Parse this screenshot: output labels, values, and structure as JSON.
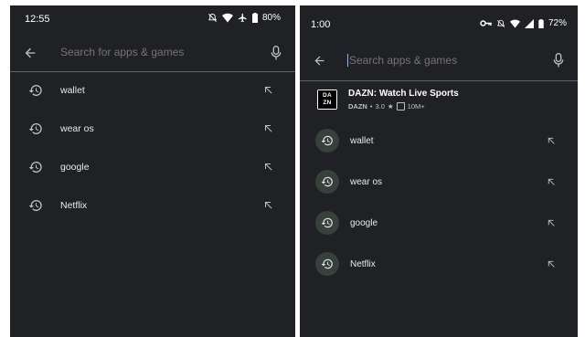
{
  "left": {
    "status": {
      "time": "12:55",
      "battery": "80%"
    },
    "search": {
      "placeholder": "Search for apps & games"
    },
    "history": [
      "wallet",
      "wear os",
      "google",
      "Netflix"
    ]
  },
  "right": {
    "status": {
      "time": "1:00",
      "battery": "72%"
    },
    "search": {
      "placeholder": "Search apps & games"
    },
    "app": {
      "logo_line1": "DA",
      "logo_line2": "ZN",
      "title": "DAZN: Watch Live Sports",
      "publisher": "DAZN",
      "rating": "3.0",
      "rating_star": "★",
      "separator": "•",
      "downloads": "10M+"
    },
    "history": [
      "wallet",
      "wear os",
      "google",
      "Netflix"
    ]
  },
  "colors": {
    "background": "#202124",
    "accent_circle": "#37403b",
    "divider": "#5f6368"
  }
}
